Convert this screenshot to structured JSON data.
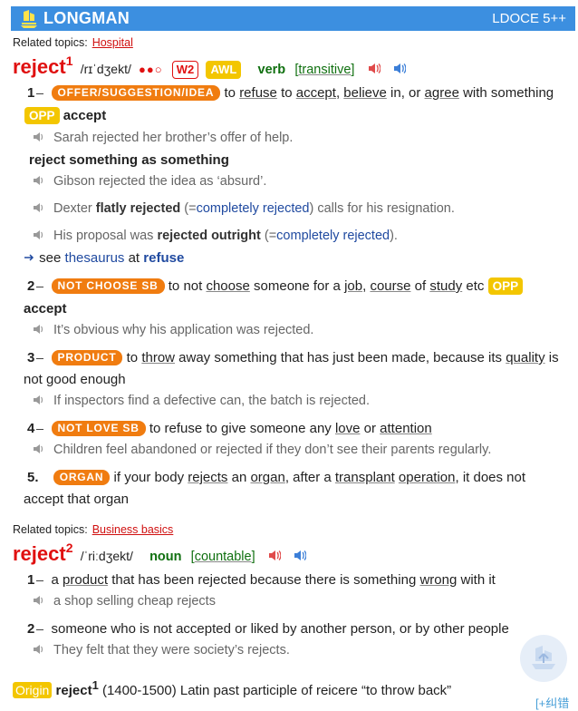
{
  "header": {
    "brand": "LONGMAN",
    "edition": "LDOCE 5++"
  },
  "entry1": {
    "topics_label": "Related topics:",
    "topic": "Hospital",
    "headword": "reject",
    "homnum": "1",
    "pron": "/rɪˈdʒekt/",
    "freq_dots": "●●○",
    "w_badge": "W2",
    "awl_badge": "AWL",
    "pos": "verb",
    "gram_open": "[",
    "gram": "transitive",
    "gram_close": "]",
    "senses": {
      "s1": {
        "num": "1",
        "signpost": "OFFER/SUGGESTION/IDEA",
        "def_parts": [
          "to",
          "refuse",
          "to",
          "accept,",
          "believe",
          "in, or",
          "agree",
          "with something"
        ],
        "opp_badge": "OPP",
        "opp_word": "accept",
        "ex1": "Sarah rejected her brother’s offer of help.",
        "collo": "reject something as something",
        "ex2": "Gibson rejected the idea as ‘absurd’.",
        "ex3_a": "Dexter ",
        "ex3_b": "flatly rejected",
        "ex3_c": " (=",
        "ex3_d": "completely rejected",
        "ex3_e": ") calls for his resignation.",
        "ex4_a": "His proposal was ",
        "ex4_b": "rejected outright",
        "ex4_c": " (=",
        "ex4_d": "completely rejected",
        "ex4_e": ").",
        "see_label": "see",
        "see_thesaurus": "thesaurus",
        "see_at": "at",
        "see_word": "refuse"
      },
      "s2": {
        "num": "2",
        "signpost": "NOT CHOOSE SB",
        "def_a": "to not ",
        "def_choose": "choose",
        "def_b": " someone for a ",
        "def_job": "job",
        "def_c": ", ",
        "def_course": "course",
        "def_d": " of ",
        "def_study": "study",
        "def_e": " etc",
        "opp_badge": "OPP",
        "opp_word": "accept",
        "ex1": "It’s obvious why his application was rejected."
      },
      "s3": {
        "num": "3",
        "signpost": "PRODUCT",
        "def_a": "to ",
        "def_throw": "throw",
        "def_b": " away something that has just been made, because its ",
        "def_quality": "quality",
        "def_c": " is",
        "def_line2": "not good enough",
        "ex1": "If inspectors find a defective can, the batch is rejected."
      },
      "s4": {
        "num": "4",
        "signpost": "NOT LOVE SB",
        "def_a": "to refuse to give someone any ",
        "def_love": "love",
        "def_b": " or ",
        "def_attention": "attention",
        "ex1": "Children feel abandoned or rejected if they don’t see their parents regularly."
      },
      "s5": {
        "num": "5",
        "signpost": "ORGAN",
        "def_a": "if your body ",
        "def_rejects": "rejects",
        "def_b": " an ",
        "def_organ": "organ",
        "def_c": ", after a ",
        "def_transplant": "transplant",
        "def_d": " ",
        "def_operation": "operation",
        "def_e": ", it does not",
        "def_line2": "accept that organ"
      }
    }
  },
  "entry2": {
    "topics_label": "Related topics:",
    "topic": "Business basics",
    "headword": "reject",
    "homnum": "2",
    "pron": "/ˈriːdʒekt/",
    "pos": "noun",
    "gram_open": "[",
    "gram": "countable",
    "gram_close": "]",
    "s1": {
      "num": "1",
      "def_a": "a ",
      "def_product": "product",
      "def_b": " that has been rejected because there is something ",
      "def_wrong": "wrong",
      "def_c": " with it",
      "ex1": "a shop selling cheap rejects"
    },
    "s2": {
      "num": "2",
      "def": "someone who is not accepted or liked by another person, or by other people",
      "ex1": "They felt that they were society’s rejects."
    }
  },
  "origin": {
    "tag": "Origin",
    "word": "reject",
    "homnum": "1",
    "text": "(1400-1500) Latin past participle of reicere “to throw back”"
  },
  "footer": {
    "report": "[+纠错"
  },
  "icons": {
    "ship": "ship-logo-icon",
    "speaker_br": "speaker-red-icon",
    "speaker_am": "speaker-blue-icon",
    "example_speaker": "speaker-grey-icon",
    "arrow": "arrow-right-icon",
    "float": "back-to-top-icon"
  },
  "colors": {
    "header_bg": "#3c8fe0",
    "headword": "#e01010",
    "signpost": "#f07c10",
    "badge_yellow": "#f3c600",
    "pos_green": "#107010",
    "link_blue": "#204aa0"
  }
}
